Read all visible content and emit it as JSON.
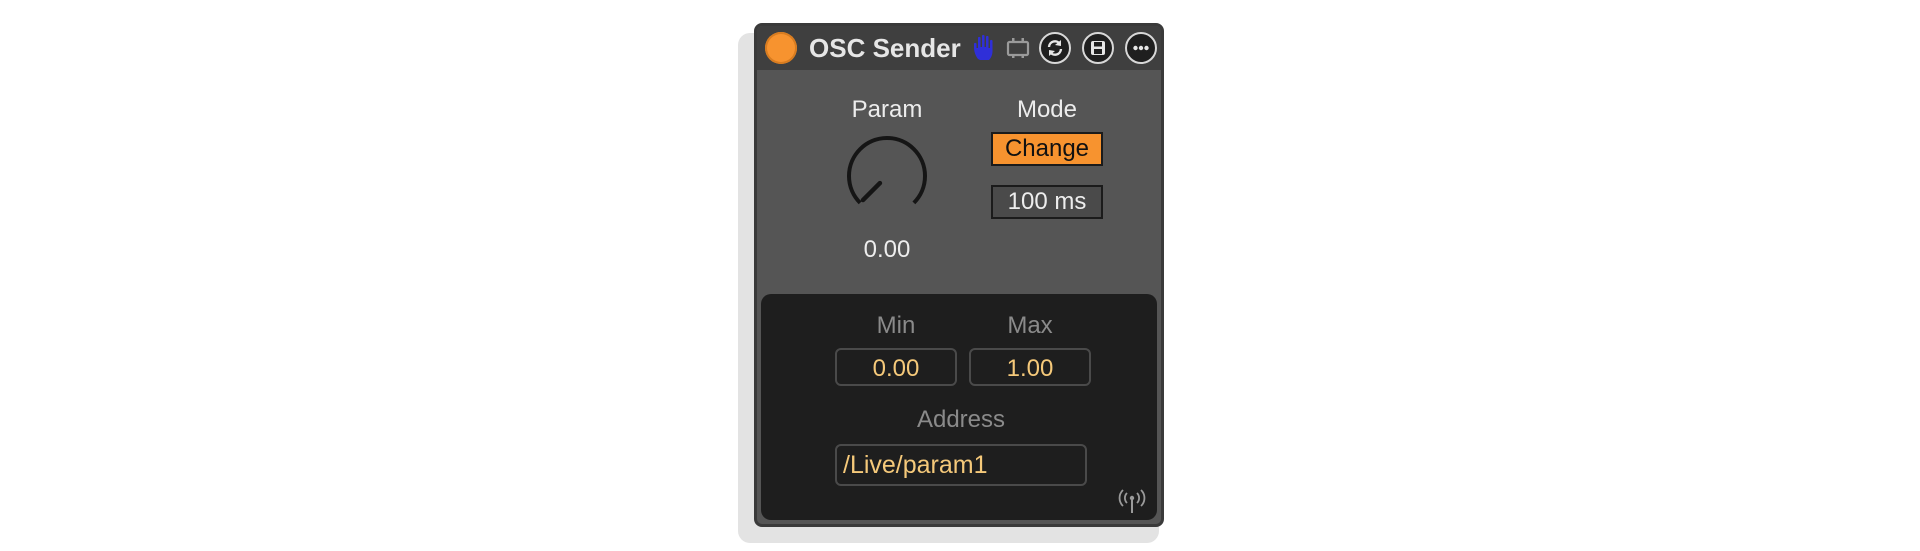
{
  "device": {
    "title": "OSC Sender",
    "power_on": true,
    "header_icons": [
      "hand-icon",
      "midi-map-icon",
      "refresh-icon",
      "save-icon",
      "more-icon"
    ]
  },
  "param": {
    "label": "Param",
    "value": "0.00",
    "level": 0.0
  },
  "mode": {
    "label": "Mode",
    "selected": "Change",
    "rate": "100 ms"
  },
  "range": {
    "min_label": "Min",
    "min_value": "0.00",
    "max_label": "Max",
    "max_value": "1.00"
  },
  "address": {
    "label": "Address",
    "value": "/Live/param1"
  },
  "status_icon": "antenna-icon",
  "colors": {
    "accent": "#f7932f",
    "panel": "#555555",
    "value_text": "#f5c97a",
    "hand": "#2f2fd8"
  }
}
